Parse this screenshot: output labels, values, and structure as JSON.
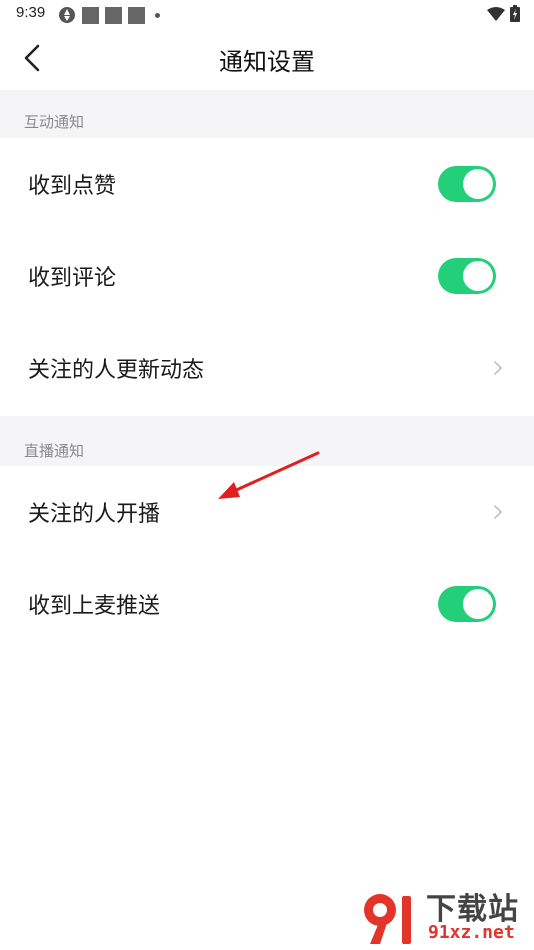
{
  "status_bar": {
    "time": "9:39"
  },
  "header": {
    "title": "通知设置"
  },
  "sections": [
    {
      "title": "互动通知",
      "rows": [
        {
          "label": "收到点赞",
          "control": "toggle",
          "on": true
        },
        {
          "label": "收到评论",
          "control": "toggle",
          "on": true
        },
        {
          "label": "关注的人更新动态",
          "control": "chevron"
        }
      ]
    },
    {
      "title": "直播通知",
      "rows": [
        {
          "label": "关注的人开播",
          "control": "chevron"
        },
        {
          "label": "收到上麦推送",
          "control": "toggle",
          "on": true
        }
      ]
    }
  ],
  "colors": {
    "toggle_on": "#24cf7a",
    "section_bg": "#f5f5f7",
    "arrow": "#e01f1f"
  },
  "watermark": {
    "title": "下载站",
    "site": "91xz.net"
  }
}
